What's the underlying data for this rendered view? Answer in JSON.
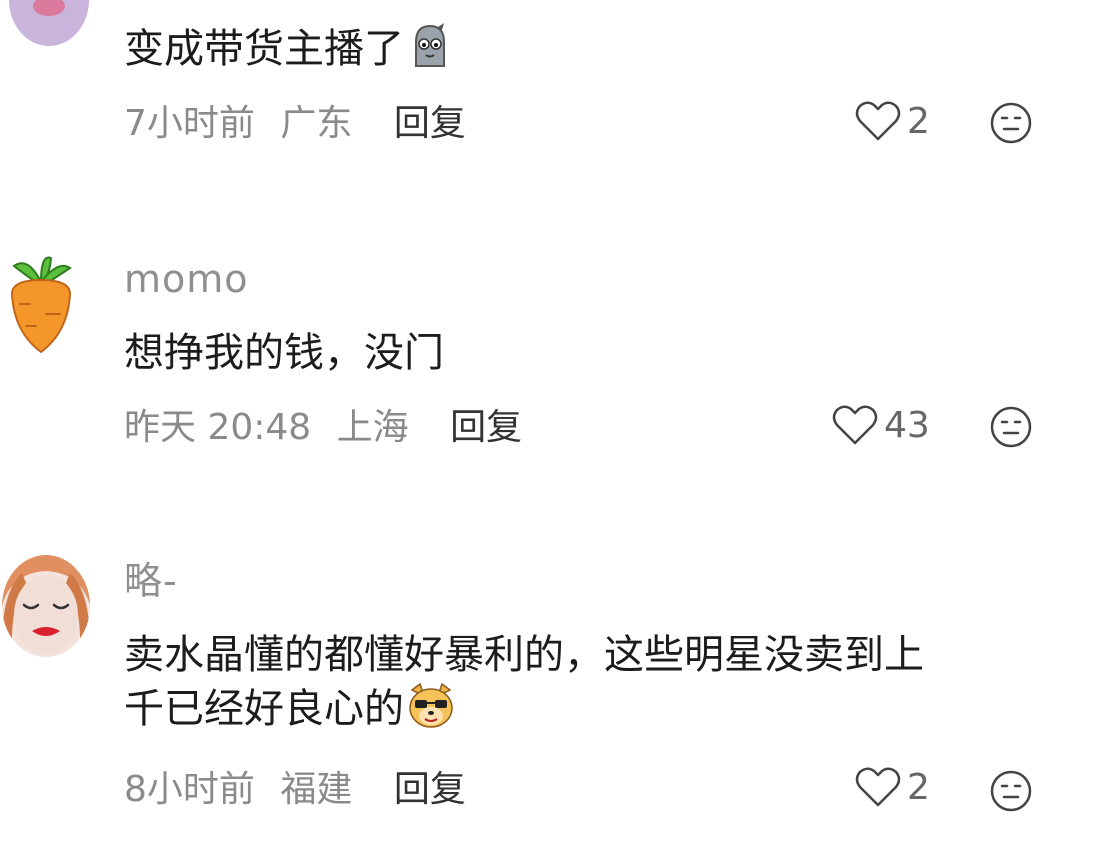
{
  "comments": [
    {
      "username": "",
      "content": "变成带货主播了",
      "emoji_icon": "ghost-emoji-icon",
      "time": "7小时前",
      "region": "广东",
      "reply_label": "回复",
      "likes": "2"
    },
    {
      "username": "momo",
      "content": "想挣我的钱，没门",
      "time": "昨天 20:48",
      "region": "上海",
      "reply_label": "回复",
      "likes": "43"
    },
    {
      "username": "略-",
      "content_line1": "卖水晶懂的都懂好暴利的，这些明星没卖到上",
      "content_line2": "千已经好良心的",
      "emoji_icon": "smug-dog-emoji-icon",
      "time": "8小时前",
      "region": "福建",
      "reply_label": "回复",
      "likes": "2"
    }
  ],
  "icons": {
    "like": "heart-outline-icon",
    "dislike": "neutral-face-icon"
  },
  "colors": {
    "text_primary": "#1c1c1c",
    "text_meta": "#8a8a8a",
    "username": "#8f8f8f",
    "background": "#ffffff"
  }
}
